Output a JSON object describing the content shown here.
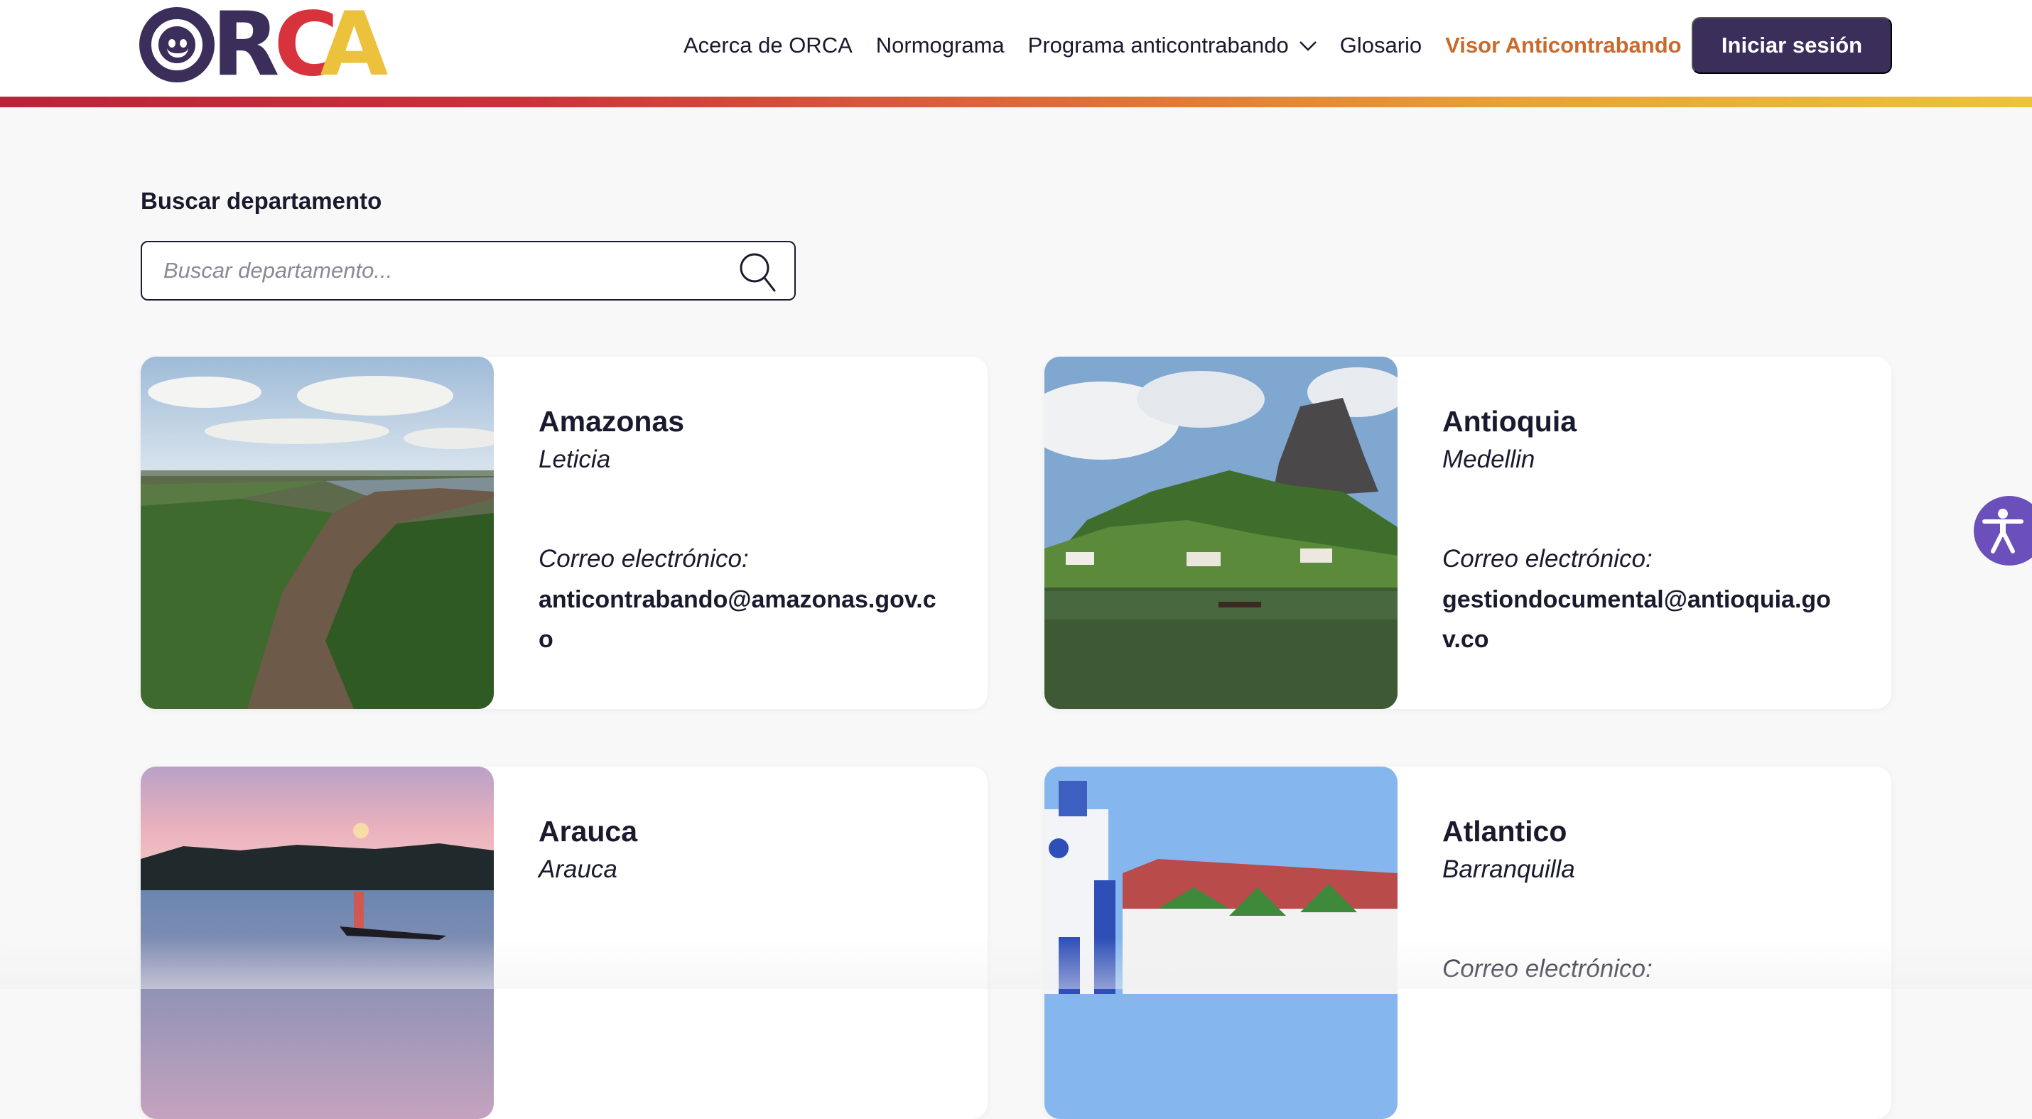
{
  "header": {
    "logo_text": "ORCA",
    "nav": [
      {
        "label": "Acerca de ORCA",
        "has_dropdown": false,
        "active": false
      },
      {
        "label": "Normograma",
        "has_dropdown": false,
        "active": false
      },
      {
        "label": "Programa anticontrabando",
        "has_dropdown": true,
        "active": false
      },
      {
        "label": "Glosario",
        "has_dropdown": false,
        "active": false
      },
      {
        "label": "Visor Anticontrabando",
        "has_dropdown": true,
        "active": true
      }
    ],
    "login_label": "Iniciar sesión"
  },
  "search": {
    "label": "Buscar departamento",
    "placeholder": "Buscar departamento...",
    "value": ""
  },
  "departments": [
    {
      "name": "Amazonas",
      "capital": "Leticia",
      "email_label": "Correo electrónico:",
      "email": "anticontrabando@amazonas.gov.co",
      "image": "river-aerial"
    },
    {
      "name": "Antioquia",
      "capital": "Medellin",
      "email_label": "Correo electrónico:",
      "email": "gestiondocumental@antioquia.gov.co",
      "image": "rock-lake"
    },
    {
      "name": "Arauca",
      "capital": "Arauca",
      "email_label": "",
      "email": "",
      "image": "river-sunset"
    },
    {
      "name": "Atlantico",
      "capital": "Barranquilla",
      "email_label": "Correo electrónico:",
      "email": "",
      "image": "church-palms"
    }
  ],
  "colors": {
    "primary": "#3c2e5a",
    "accent_active": "#c96a2c",
    "stripe_start": "#b8243a",
    "stripe_end": "#ecc23c",
    "accessibility": "#6b4fbb"
  },
  "icons": {
    "search": "search-icon",
    "dropdown": "chevron-down-icon",
    "accessibility": "accessibility-icon"
  }
}
